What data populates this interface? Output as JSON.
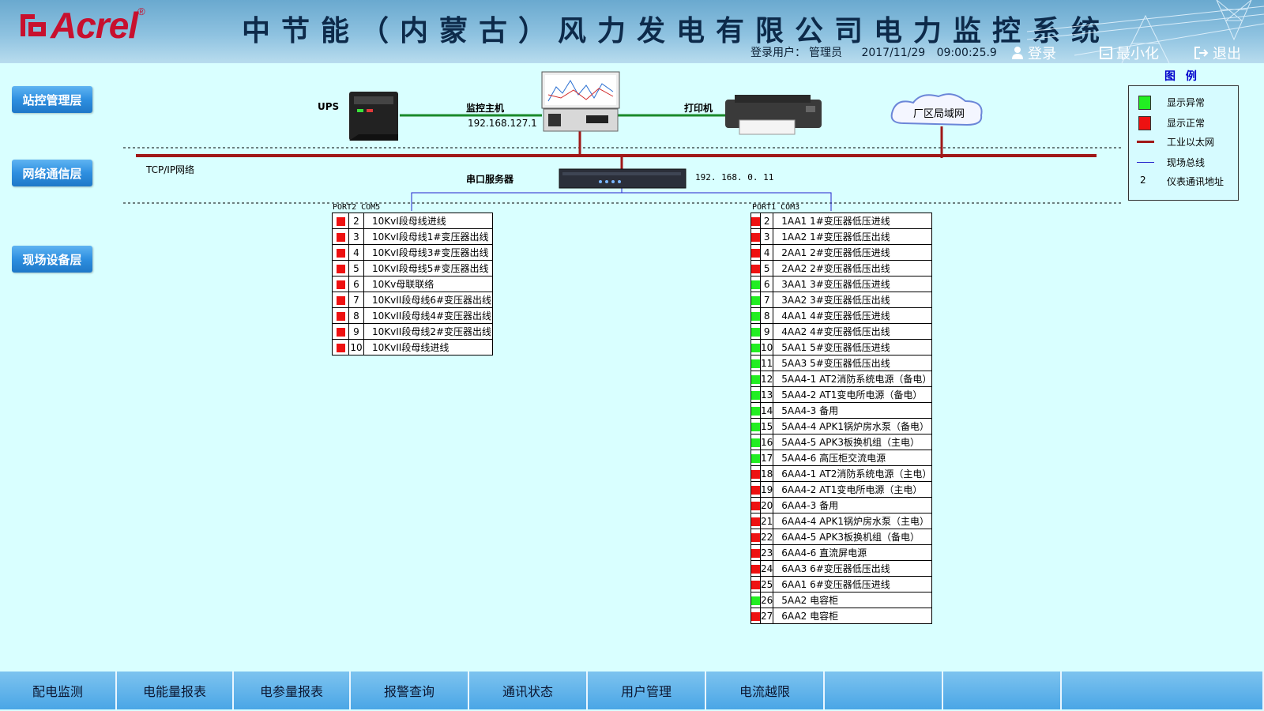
{
  "header": {
    "logo_text": "Acrel",
    "logo_reg": "®",
    "title": "中节能（内蒙古）风力发电有限公司电力监控系统",
    "login_label": "登录用户：",
    "user": "管理员",
    "date": "2017/11/29",
    "time": "09:00:25.9",
    "buttons": {
      "login": "登录",
      "minimize": "最小化",
      "logout": "退出"
    }
  },
  "layers": [
    "站控管理层",
    "网络通信层",
    "现场设备层"
  ],
  "topology": {
    "ups": "UPS",
    "host_label": "监控主机",
    "host_ip": "192.168.127.1",
    "printer": "打印机",
    "lan": "厂区局域网",
    "network": "TCP/IP网络",
    "serial_server": "串口服务器",
    "serial_ip": "192. 168. 0. 11"
  },
  "port_left": {
    "title": "PORT2  COM5",
    "rows": [
      {
        "status": "red",
        "id": "2",
        "name": "10KvI段母线进线"
      },
      {
        "status": "red",
        "id": "3",
        "name": "10KvI段母线1#变压器出线"
      },
      {
        "status": "red",
        "id": "4",
        "name": "10KvI段母线3#变压器出线"
      },
      {
        "status": "red",
        "id": "5",
        "name": "10KvI段母线5#变压器出线"
      },
      {
        "status": "red",
        "id": "6",
        "name": "10Kv母联联络"
      },
      {
        "status": "red",
        "id": "7",
        "name": "10KvII段母线6#变压器出线"
      },
      {
        "status": "red",
        "id": "8",
        "name": "10KvII段母线4#变压器出线"
      },
      {
        "status": "red",
        "id": "9",
        "name": "10KvII段母线2#变压器出线"
      },
      {
        "status": "red",
        "id": "10",
        "name": "10KvII段母线进线"
      }
    ]
  },
  "port_right": {
    "title": "PORT1  COM3",
    "rows": [
      {
        "status": "red",
        "id": "2",
        "name": "1AA1 1#变压器低压进线"
      },
      {
        "status": "red",
        "id": "3",
        "name": "1AA2 1#变压器低压出线"
      },
      {
        "status": "red",
        "id": "4",
        "name": "2AA1 2#变压器低压进线"
      },
      {
        "status": "red",
        "id": "5",
        "name": "2AA2 2#变压器低压出线"
      },
      {
        "status": "green",
        "id": "6",
        "name": "3AA1 3#变压器低压进线"
      },
      {
        "status": "green",
        "id": "7",
        "name": "3AA2 3#变压器低压出线"
      },
      {
        "status": "green",
        "id": "8",
        "name": "4AA1 4#变压器低压进线"
      },
      {
        "status": "green",
        "id": "9",
        "name": "4AA2 4#变压器低压出线"
      },
      {
        "status": "green",
        "id": "10",
        "name": "5AA1 5#变压器低压进线"
      },
      {
        "status": "green",
        "id": "11",
        "name": "5AA3 5#变压器低压出线"
      },
      {
        "status": "green",
        "id": "12",
        "name": "5AA4-1 AT2消防系统电源（备电）"
      },
      {
        "status": "green",
        "id": "13",
        "name": "5AA4-2 AT1变电所电源（备电）"
      },
      {
        "status": "green",
        "id": "14",
        "name": "5AA4-3 备用"
      },
      {
        "status": "green",
        "id": "15",
        "name": "5AA4-4 APK1锅炉房水泵（备电）"
      },
      {
        "status": "green",
        "id": "16",
        "name": "5AA4-5 APK3板换机组（主电）"
      },
      {
        "status": "green",
        "id": "17",
        "name": "5AA4-6 高压柜交流电源"
      },
      {
        "status": "red",
        "id": "18",
        "name": "6AA4-1 AT2消防系统电源（主电）"
      },
      {
        "status": "red",
        "id": "19",
        "name": "6AA4-2 AT1变电所电源（主电）"
      },
      {
        "status": "red",
        "id": "20",
        "name": "6AA4-3 备用"
      },
      {
        "status": "red",
        "id": "21",
        "name": "6AA4-4 APK1锅炉房水泵（主电）"
      },
      {
        "status": "red",
        "id": "22",
        "name": "6AA4-5 APK3板换机组（备电）"
      },
      {
        "status": "red",
        "id": "23",
        "name": "6AA4-6 直流屏电源"
      },
      {
        "status": "red",
        "id": "24",
        "name": "6AA3 6#变压器低压出线"
      },
      {
        "status": "red",
        "id": "25",
        "name": "6AA1 6#变压器低压进线"
      },
      {
        "status": "green",
        "id": "26",
        "name": "5AA2 电容柜"
      },
      {
        "status": "red",
        "id": "27",
        "name": "6AA2 电容柜"
      }
    ]
  },
  "legend": {
    "title": "图 例",
    "items": [
      {
        "type": "green",
        "label": "显示异常"
      },
      {
        "type": "red",
        "label": "显示正常"
      },
      {
        "type": "ethernet",
        "label": "工业以太网"
      },
      {
        "type": "bus",
        "label": "现场总线"
      },
      {
        "type": "number",
        "symbol": "2",
        "label": "仪表通讯地址"
      }
    ]
  },
  "footer_tabs": [
    "配电监测",
    "电能量报表",
    "电参量报表",
    "报警查询",
    "通讯状态",
    "用户管理",
    "电流越限",
    "",
    "",
    ""
  ],
  "colors": {
    "background": "#d9ffff",
    "ethernet": "#a01818",
    "bus": "#2222cc",
    "link": "#1a8a2a",
    "normal": "#ee1111",
    "abnormal": "#22ee22"
  }
}
